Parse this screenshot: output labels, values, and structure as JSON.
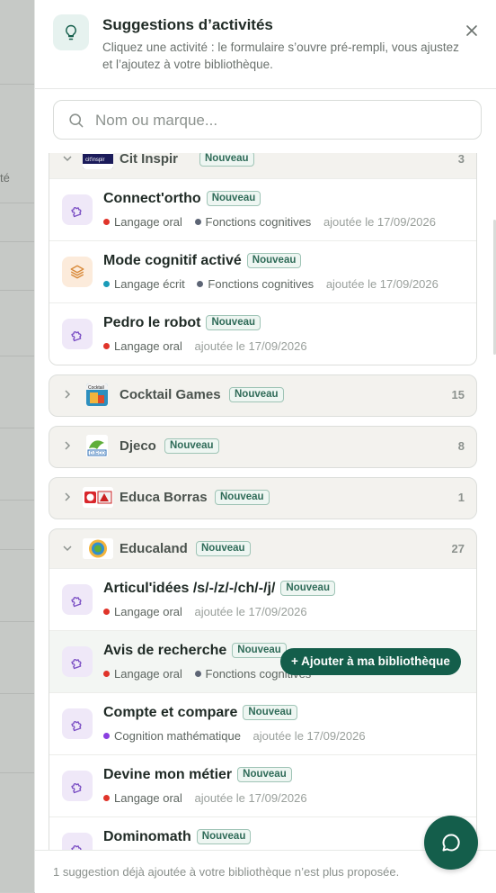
{
  "backdrop": {
    "fragment": "té"
  },
  "header": {
    "title": "Suggestions d’activités",
    "subtitle": "Cliquez une activité : le formulaire s’ouvre pré-rempli, vous ajustez et l’ajoutez à votre bibliothèque."
  },
  "search": {
    "placeholder": "Nom ou marque..."
  },
  "groups": [
    {
      "name": "Cit Inspir",
      "badge": "Nouveau",
      "count": "3",
      "expanded": true,
      "logo": "cit-inspir-logo",
      "items": [
        {
          "name": "Connect'ortho",
          "badge": "Nouveau",
          "icon": "puzzle-icon",
          "tags": [
            {
              "label": "Langage oral",
              "color": "#e0342a"
            },
            {
              "label": "Fonctions cognitives",
              "color": "#5d6575"
            }
          ],
          "added": "ajoutée le 17/09/2026"
        },
        {
          "name": "Mode cognitif activé",
          "badge": "Nouveau",
          "icon": "layers-icon",
          "tags": [
            {
              "label": "Langage écrit",
              "color": "#1a9bb8"
            },
            {
              "label": "Fonctions cognitives",
              "color": "#5d6575"
            }
          ],
          "added": "ajoutée le 17/09/2026"
        },
        {
          "name": "Pedro le robot",
          "badge": "Nouveau",
          "icon": "puzzle-icon",
          "tags": [
            {
              "label": "Langage oral",
              "color": "#e0342a"
            }
          ],
          "added": "ajoutée le 17/09/2026"
        }
      ]
    },
    {
      "name": "Cocktail Games",
      "badge": "Nouveau",
      "count": "15",
      "expanded": false,
      "logo": "cocktail-games-logo"
    },
    {
      "name": "Djeco",
      "badge": "Nouveau",
      "count": "8",
      "expanded": false,
      "logo": "djeco-logo"
    },
    {
      "name": "Educa Borras",
      "badge": "Nouveau",
      "count": "1",
      "expanded": false,
      "logo": "educa-borras-logo"
    },
    {
      "name": "Educaland",
      "badge": "Nouveau",
      "count": "27",
      "expanded": true,
      "logo": "educaland-logo",
      "items": [
        {
          "name": "Articul'idées /s/-/z/-/ch/-/j/",
          "badge": "Nouveau",
          "icon": "puzzle-icon",
          "tags": [
            {
              "label": "Langage oral",
              "color": "#e0342a"
            }
          ],
          "added": "ajoutée le 17/09/2026"
        },
        {
          "name": "Avis de recherche",
          "badge": "Nouveau",
          "icon": "puzzle-icon",
          "tags": [
            {
              "label": "Langage oral",
              "color": "#e0342a"
            },
            {
              "label": "Fonctions cognitives",
              "color": "#5d6575"
            }
          ],
          "added": "",
          "hover_action": "Ajouter à ma bibliothèque"
        },
        {
          "name": "Compte et compare",
          "badge": "Nouveau",
          "icon": "puzzle-icon",
          "tags": [
            {
              "label": "Cognition mathématique",
              "color": "#8a3fe0"
            }
          ],
          "added": "ajoutée le 17/09/2026"
        },
        {
          "name": "Devine mon métier",
          "badge": "Nouveau",
          "icon": "puzzle-icon",
          "tags": [
            {
              "label": "Langage oral",
              "color": "#e0342a"
            }
          ],
          "added": "ajoutée le 17/09/2026"
        },
        {
          "name": "Dominomath",
          "badge": "Nouveau",
          "icon": "puzzle-icon",
          "tags": [],
          "added": ""
        }
      ]
    }
  ],
  "footer": {
    "note": "1 suggestion déjà ajoutée à votre bibliothèque n’est plus proposée."
  },
  "colors": {
    "accent": "#145e4b",
    "badge_text": "#2f6b58"
  }
}
